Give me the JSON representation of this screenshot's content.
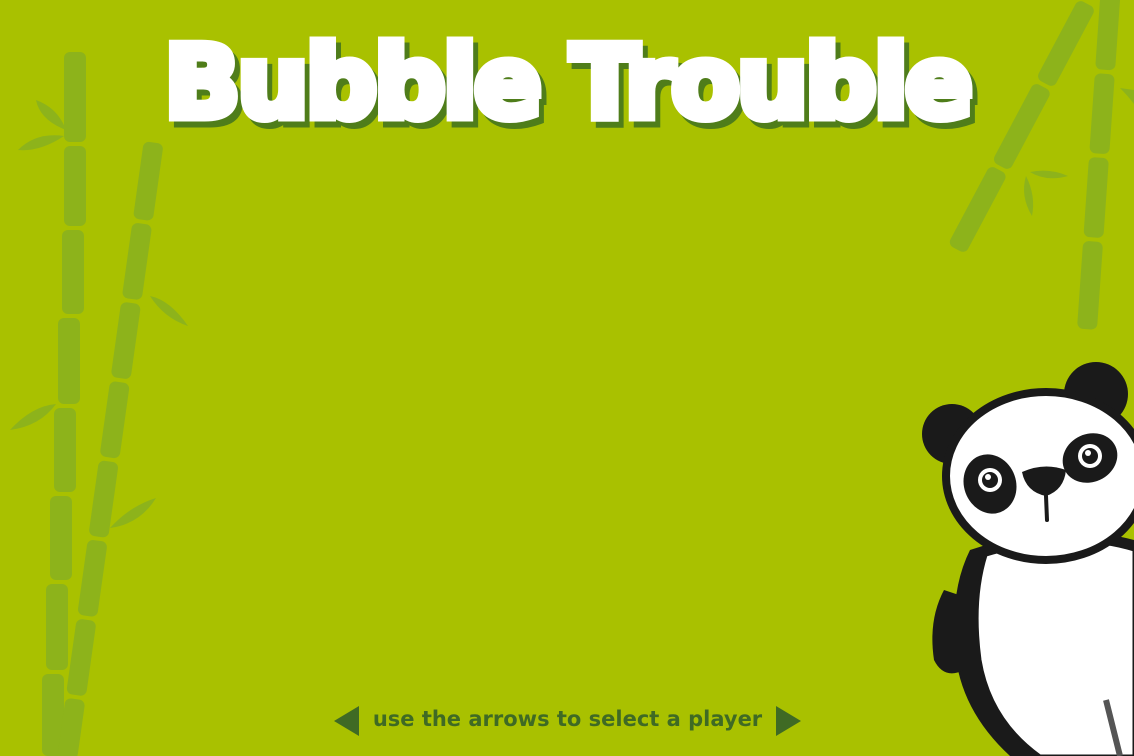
{
  "game": {
    "title": "Bubble Trouble",
    "hint": "use the arrows to select a player"
  },
  "controls": {
    "prev_arrow_icon": "triangle-left-icon",
    "next_arrow_icon": "triangle-right-icon"
  },
  "player": {
    "character": "panda"
  },
  "colors": {
    "background": "#a9c100",
    "bamboo": "#8cb11a",
    "title_fill": "#ffffff",
    "title_shadow": "#4f7d1a",
    "hint_text": "#3f6a24"
  }
}
